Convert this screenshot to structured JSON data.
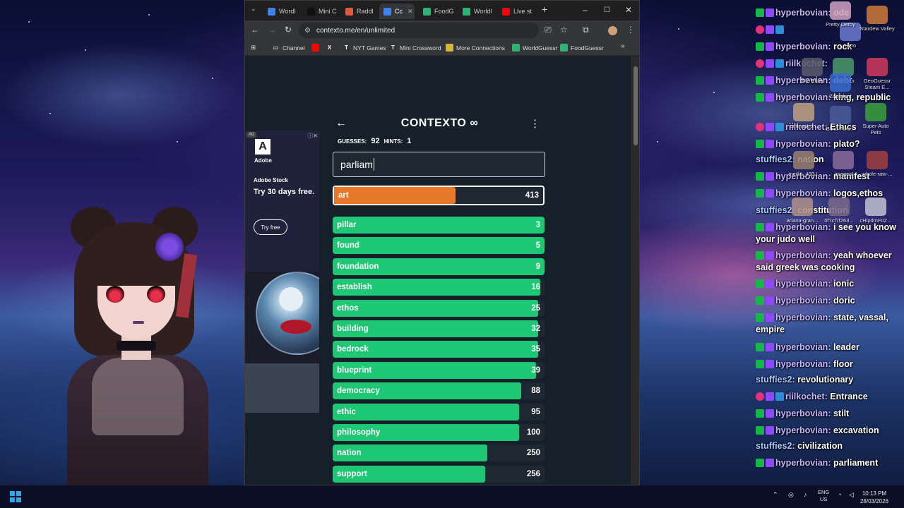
{
  "browser": {
    "tabs": [
      {
        "label": "Wordl",
        "icon": "grid-icon",
        "color": "#3c82f6"
      },
      {
        "label": "Mini C",
        "icon": "nyt-icon",
        "color": "#111111"
      },
      {
        "label": "Raddl",
        "icon": "raddle-icon",
        "color": "#e2583e"
      },
      {
        "label": "Cc",
        "icon": "contexto-icon",
        "color": "#3c82f6",
        "active": true
      },
      {
        "label": "FoodG",
        "icon": "globe-icon",
        "color": "#2bb573"
      },
      {
        "label": "Worldl",
        "icon": "globe-icon",
        "color": "#2bb573"
      },
      {
        "label": "Live st",
        "icon": "youtube-icon",
        "color": "#ff0000"
      }
    ],
    "url": "contexto.me/en/unlimited",
    "bookmarks": [
      {
        "label": "Channel",
        "icon": "folder-icon"
      },
      {
        "label": "",
        "icon": "youtube-icon"
      },
      {
        "label": "",
        "icon": "x-icon"
      },
      {
        "label": "NYT Games",
        "icon": "nyt-icon"
      },
      {
        "label": "Mini Crossword",
        "icon": "nyt-icon"
      },
      {
        "label": "More Connections",
        "icon": "grid-icon"
      },
      {
        "label": "WorldGuessr",
        "icon": "globe-icon"
      },
      {
        "label": "FoodGuessr",
        "icon": "globe-icon"
      }
    ]
  },
  "ad": {
    "badge": "AD",
    "logo_text": "A",
    "brand_name": "Adobe",
    "product": "Adobe Stock",
    "headline": "Try 30 days free.",
    "button": "Try free"
  },
  "game": {
    "title": "CONTEXTO ∞",
    "guesses_label": "GUESSES:",
    "guesses": "92",
    "hints_label": "HINTS:",
    "hints": "1",
    "input_value": "parliam",
    "last_guess": {
      "word": "art",
      "rank": 413,
      "progress": 0.58,
      "color": "#e8782a"
    },
    "guesses_list": [
      {
        "word": "pillar",
        "rank": 3,
        "progress": 1.0
      },
      {
        "word": "found",
        "rank": 5,
        "progress": 1.0
      },
      {
        "word": "foundation",
        "rank": 9,
        "progress": 1.0
      },
      {
        "word": "establish",
        "rank": 16,
        "progress": 0.98
      },
      {
        "word": "ethos",
        "rank": 25,
        "progress": 0.97
      },
      {
        "word": "building",
        "rank": 32,
        "progress": 0.97
      },
      {
        "word": "bedrock",
        "rank": 35,
        "progress": 0.97
      },
      {
        "word": "blueprint",
        "rank": 39,
        "progress": 0.96
      },
      {
        "word": "democracy",
        "rank": 88,
        "progress": 0.89
      },
      {
        "word": "ethic",
        "rank": 95,
        "progress": 0.88
      },
      {
        "word": "philosophy",
        "rank": 100,
        "progress": 0.88
      },
      {
        "word": "nation",
        "rank": 250,
        "progress": 0.73
      },
      {
        "word": "support",
        "rank": 256,
        "progress": 0.72
      }
    ],
    "green": "#1ec773",
    "bg": "#15202b"
  },
  "chat": [
    {
      "user": "hyperbovian:",
      "text": "ode",
      "badges": [
        "g",
        "p"
      ]
    },
    {
      "user": "",
      "text": "",
      "badges": [
        "h",
        "p",
        "v"
      ]
    },
    {
      "user": "hyperbovian:",
      "text": "rock",
      "badges": [
        "g",
        "p"
      ]
    },
    {
      "user": "riilkochet:",
      "text": "",
      "badges": [
        "h",
        "p",
        "v"
      ]
    },
    {
      "user": "hyperbovian:",
      "text": "debt",
      "badges": [
        "g",
        "p"
      ]
    },
    {
      "user": "hyperbovian:",
      "text": "king, republic",
      "badges": [
        "g",
        "p"
      ]
    },
    {
      "user": "riilkochet:",
      "text": "Ethics",
      "badges": [
        "h",
        "p",
        "v"
      ]
    },
    {
      "user": "hyperbovian:",
      "text": "plato?",
      "badges": [
        "g",
        "p"
      ]
    },
    {
      "user": "stuffies2:",
      "text": "nation",
      "badges": []
    },
    {
      "user": "hyperbovian:",
      "text": "manifest",
      "badges": [
        "g",
        "p"
      ]
    },
    {
      "user": "hyperbovian:",
      "text": "logos,ethos",
      "badges": [
        "g",
        "p"
      ]
    },
    {
      "user": "stuffies2:",
      "text": "constitution",
      "badges": []
    },
    {
      "user": "hyperbovian:",
      "text": "i see you know your judo well",
      "badges": [
        "g",
        "p"
      ]
    },
    {
      "user": "hyperbovian:",
      "text": "yeah whoever said greek was cooking",
      "badges": [
        "g",
        "p"
      ]
    },
    {
      "user": "hyperbovian:",
      "text": "ionic",
      "badges": [
        "g",
        "p"
      ]
    },
    {
      "user": "hyperbovian:",
      "text": "doric",
      "badges": [
        "g",
        "p"
      ]
    },
    {
      "user": "hyperbovian:",
      "text": "state, vassal, empire",
      "badges": [
        "g",
        "p"
      ]
    },
    {
      "user": "hyperbovian:",
      "text": "leader",
      "badges": [
        "g",
        "p"
      ]
    },
    {
      "user": "hyperbovian:",
      "text": "floor",
      "badges": [
        "g",
        "p"
      ]
    },
    {
      "user": "stuffies2:",
      "text": "revolutionary",
      "badges": []
    },
    {
      "user": "riilkochet:",
      "text": "Entrance",
      "badges": [
        "h",
        "p",
        "v"
      ]
    },
    {
      "user": "hyperbovian:",
      "text": "stilt",
      "badges": [
        "g",
        "p"
      ]
    },
    {
      "user": "hyperbovian:",
      "text": "excavation",
      "badges": [
        "g",
        "p"
      ]
    },
    {
      "user": "stuffies2:",
      "text": "civilization",
      "badges": []
    },
    {
      "user": "hyperbovian:",
      "text": "parliament",
      "badges": [
        "g",
        "p"
      ]
    }
  ],
  "desktop_icons": [
    {
      "label": "Hero",
      "color": "#6a7ad0"
    },
    {
      "label": "Stardew Valley",
      "color": "#d07a3a"
    },
    {
      "label": "Wiseman",
      "color": "#4a9a6a"
    },
    {
      "label": "The Elder",
      "color": "#5a5a6a"
    },
    {
      "label": "Zoomient",
      "color": "#3a6ad0"
    },
    {
      "label": "GeoGuessr Steam E...",
      "color": "#d03a5a"
    },
    {
      "label": "Pretty Derby",
      "color": "#d0a0c0"
    },
    {
      "label": "Blind Fore...",
      "color": "#4a5a9a"
    },
    {
      "label": "Super Auto Pets",
      "color": "#3aa03a"
    },
    {
      "label": "emmastro...",
      "color": "#c0a080"
    },
    {
      "label": "images",
      "color": "#8a6a9a"
    },
    {
      "label": "merlin_493...",
      "color": "#9a8070"
    },
    {
      "label": "whole-raw-...",
      "color": "#a04040"
    },
    {
      "label": "ariana-gran...",
      "color": "#b0908a"
    },
    {
      "label": "0f7cf7f263...",
      "color": "#7a6a8a"
    },
    {
      "label": "cHipdmF0Z...",
      "color": "#c0c0d0"
    }
  ],
  "taskbar": {
    "lang_top": "ENG",
    "lang_bottom": "US",
    "time": "10:13 PM",
    "date": "28/03/2026"
  }
}
